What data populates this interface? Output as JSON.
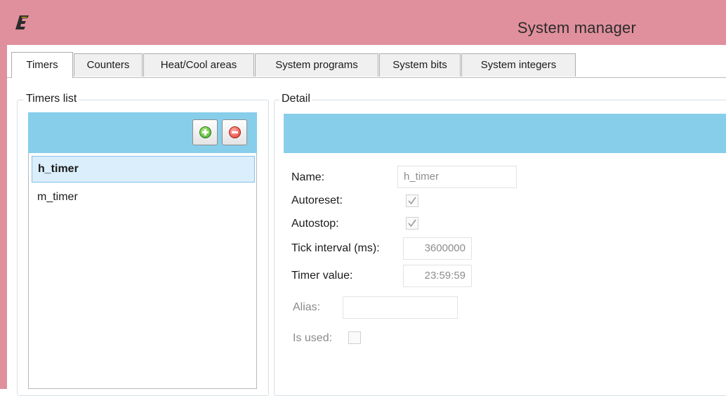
{
  "window": {
    "title": "System manager",
    "logo_icon": "eplan-logo-icon",
    "titlebar_color": "#e0909c"
  },
  "tabs": [
    {
      "label": "Timers",
      "active": true
    },
    {
      "label": "Counters",
      "active": false
    },
    {
      "label": "Heat/Cool areas",
      "active": false
    },
    {
      "label": "System programs",
      "active": false
    },
    {
      "label": "System bits",
      "active": false
    },
    {
      "label": "System integers",
      "active": false
    }
  ],
  "timers_list": {
    "group_label": "Timers list",
    "add_icon": "plus-circle-icon",
    "remove_icon": "minus-circle-icon",
    "items": [
      {
        "label": "h_timer",
        "selected": true
      },
      {
        "label": "m_timer",
        "selected": false
      }
    ]
  },
  "detail": {
    "group_label": "Detail",
    "header_color": "#87ceeb",
    "name_label": "Name:",
    "name_value": "h_timer",
    "autoreset_label": "Autoreset:",
    "autoreset_checked": true,
    "autostop_label": "Autostop:",
    "autostop_checked": true,
    "tick_interval_label": "Tick interval (ms):",
    "tick_interval_value": "3600000",
    "timer_value_label": "Timer value:",
    "timer_value": "23:59:59",
    "alias_label": "Alias:",
    "alias_value": "",
    "is_used_label": "Is used:",
    "is_used_checked": false
  }
}
